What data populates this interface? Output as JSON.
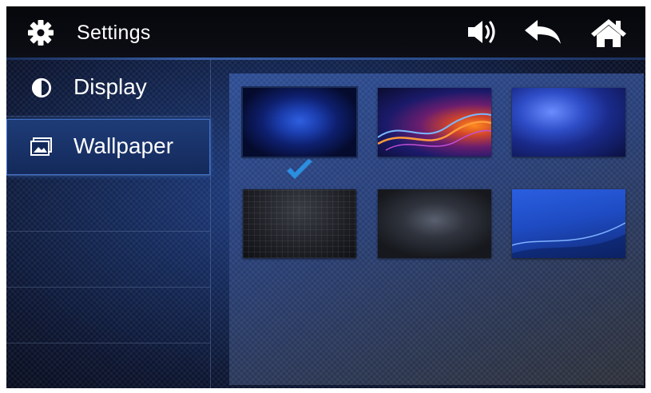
{
  "header": {
    "title": "Settings",
    "icons": [
      "gear-icon",
      "volume-icon",
      "back-icon",
      "home-icon"
    ]
  },
  "sidebar": {
    "items": [
      {
        "label": "Display",
        "icon": "contrast-icon",
        "active": false
      },
      {
        "label": "Wallpaper",
        "icon": "picture-icon",
        "active": true
      }
    ]
  },
  "wallpapers": {
    "count": 6,
    "selected_index": 0
  },
  "colors": {
    "accent": "#3a6fd0",
    "checkmark": "#2a8fe0",
    "background": "#0a0d16"
  }
}
